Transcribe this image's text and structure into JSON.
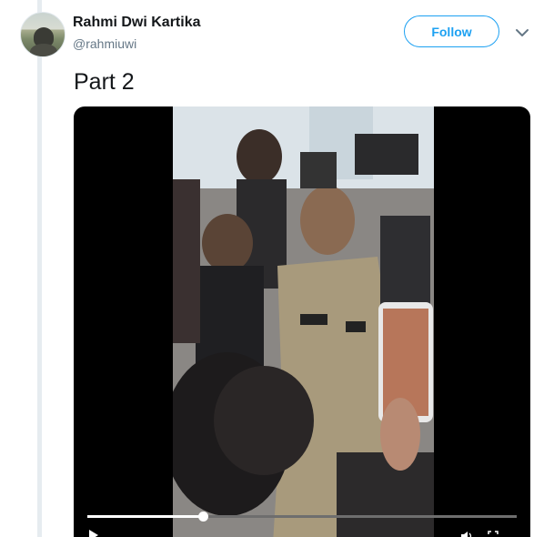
{
  "tweet": {
    "display_name": "Rahmi Dwi Kartika",
    "screen_name": "@rahmiuwi",
    "follow_label": "Follow",
    "text": "Part 2"
  },
  "media": {
    "type": "video",
    "progress": 0.27
  },
  "icons": {
    "caret": "chevron-down-icon",
    "play": "play-icon",
    "volume": "volume-icon",
    "fullscreen": "fullscreen-icon"
  },
  "colors": {
    "accent": "#1da1f2",
    "name": "#14171a",
    "handle": "#657786",
    "thread_line": "#e6ecf0",
    "video_background": "#000000"
  }
}
